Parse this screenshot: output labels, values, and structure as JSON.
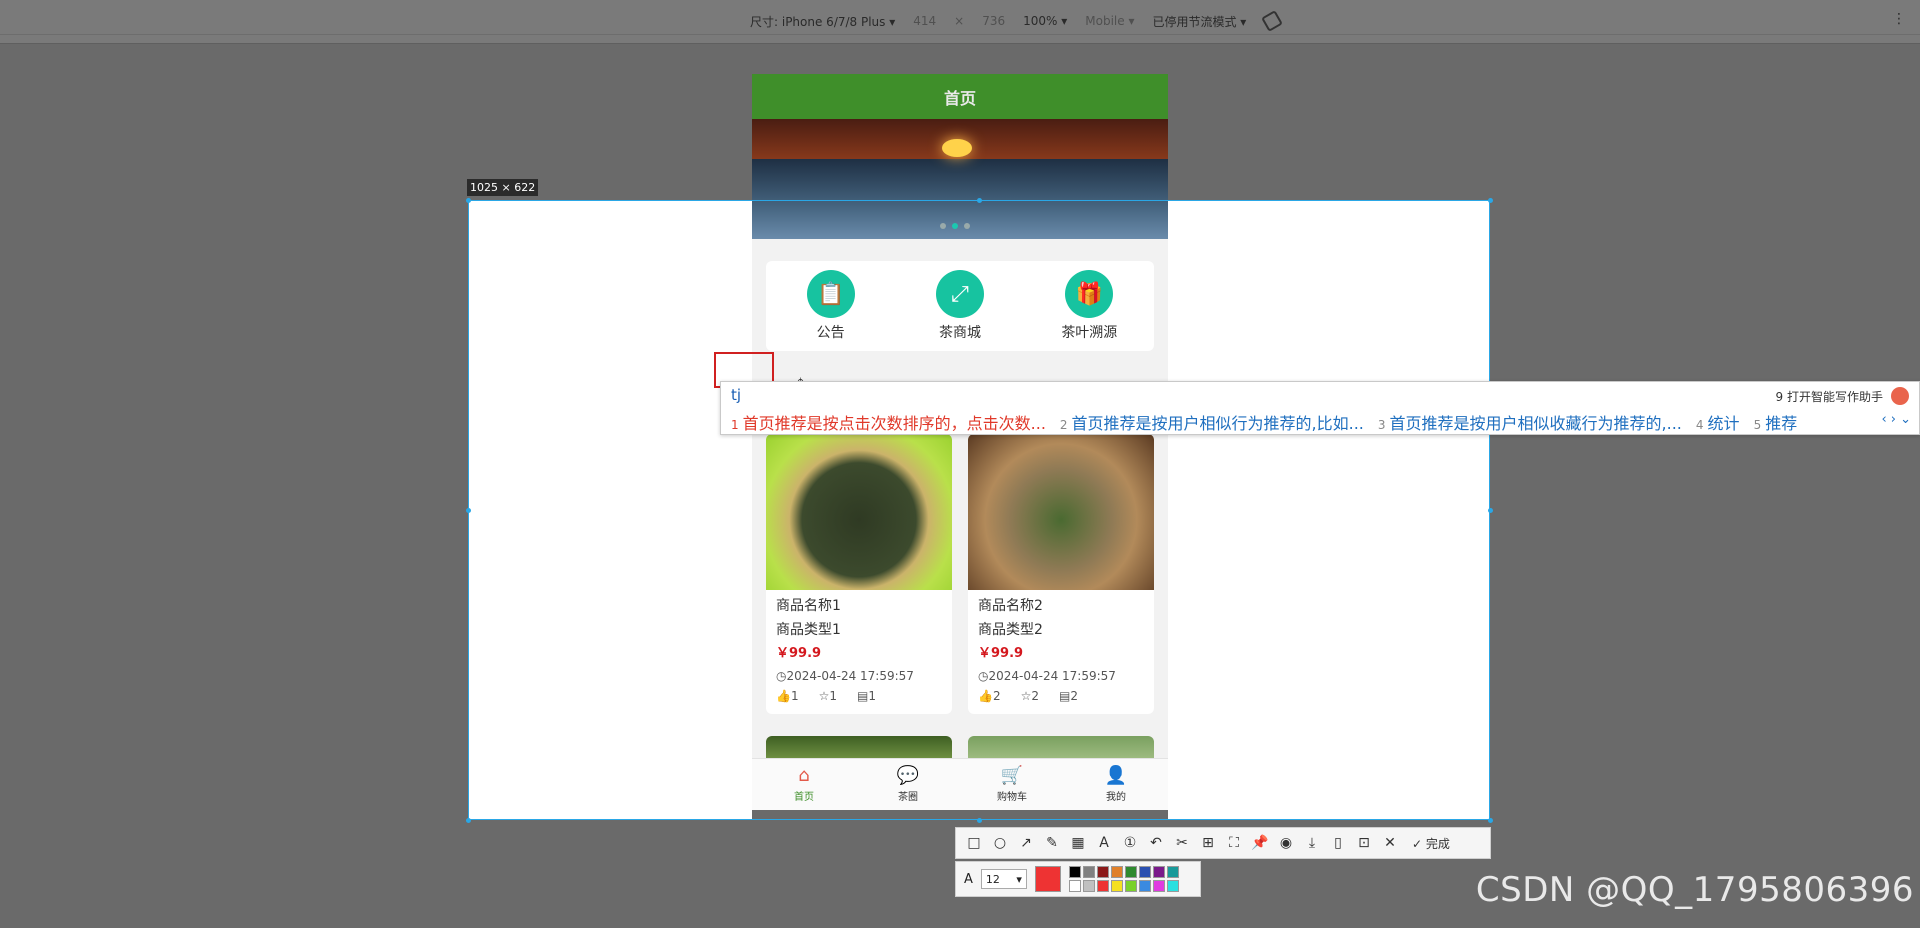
{
  "devtools": {
    "device": "尺寸: iPhone 6/7/8 Plus ▾",
    "width": "414",
    "times": "×",
    "height": "736",
    "zoom": "100% ▾",
    "mode": "Mobile ▾",
    "throttle": "已停用节流模式 ▾",
    "menu": "⋮"
  },
  "app": {
    "title": "首页",
    "nav": [
      {
        "label": "公告",
        "icon": "notice-icon",
        "glyph": "📋"
      },
      {
        "label": "茶商城",
        "icon": "expand-icon",
        "glyph": "⤢"
      },
      {
        "label": "茶叶溯源",
        "icon": "gift-icon",
        "glyph": "🎁"
      }
    ],
    "goods": [
      {
        "name": "商品名称1",
        "type": "商品类型1",
        "price": "￥99.9",
        "time": "2024-04-24 17:59:57",
        "likes": "1",
        "stars": "1",
        "views": "1"
      },
      {
        "name": "商品名称2",
        "type": "商品类型2",
        "price": "￥99.9",
        "time": "2024-04-24 17:59:57",
        "likes": "2",
        "stars": "2",
        "views": "2"
      }
    ],
    "tabs": [
      {
        "label": "首页",
        "glyph": "⌂"
      },
      {
        "label": "茶圈",
        "glyph": "💬"
      },
      {
        "label": "购物车",
        "glyph": "🛒"
      },
      {
        "label": "我的",
        "glyph": "👤"
      }
    ]
  },
  "selection": {
    "size_label": "1025 × 622"
  },
  "ime": {
    "input": "tj",
    "assist": "9 打开智能写作助手",
    "candidates": [
      {
        "num": "1",
        "text": "首页推荐是按点击次数排序的，点击次数..."
      },
      {
        "num": "2",
        "text": "首页推荐是按用户相似行为推荐的,比如..."
      },
      {
        "num": "3",
        "text": "首页推荐是按用户相似收藏行为推荐的,..."
      },
      {
        "num": "4",
        "text": "统计"
      },
      {
        "num": "5",
        "text": "推荐"
      }
    ],
    "arrows": "‹ › ⌄"
  },
  "toolbar": {
    "done": "完成",
    "font_size": "12"
  },
  "colors": {
    "header_green": "#3f8f2a",
    "accent_teal": "#17c3a0",
    "price_red": "#d4181e",
    "selection_blue": "#2aa7e6"
  },
  "watermark": "CSDN @QQ_1795806396"
}
